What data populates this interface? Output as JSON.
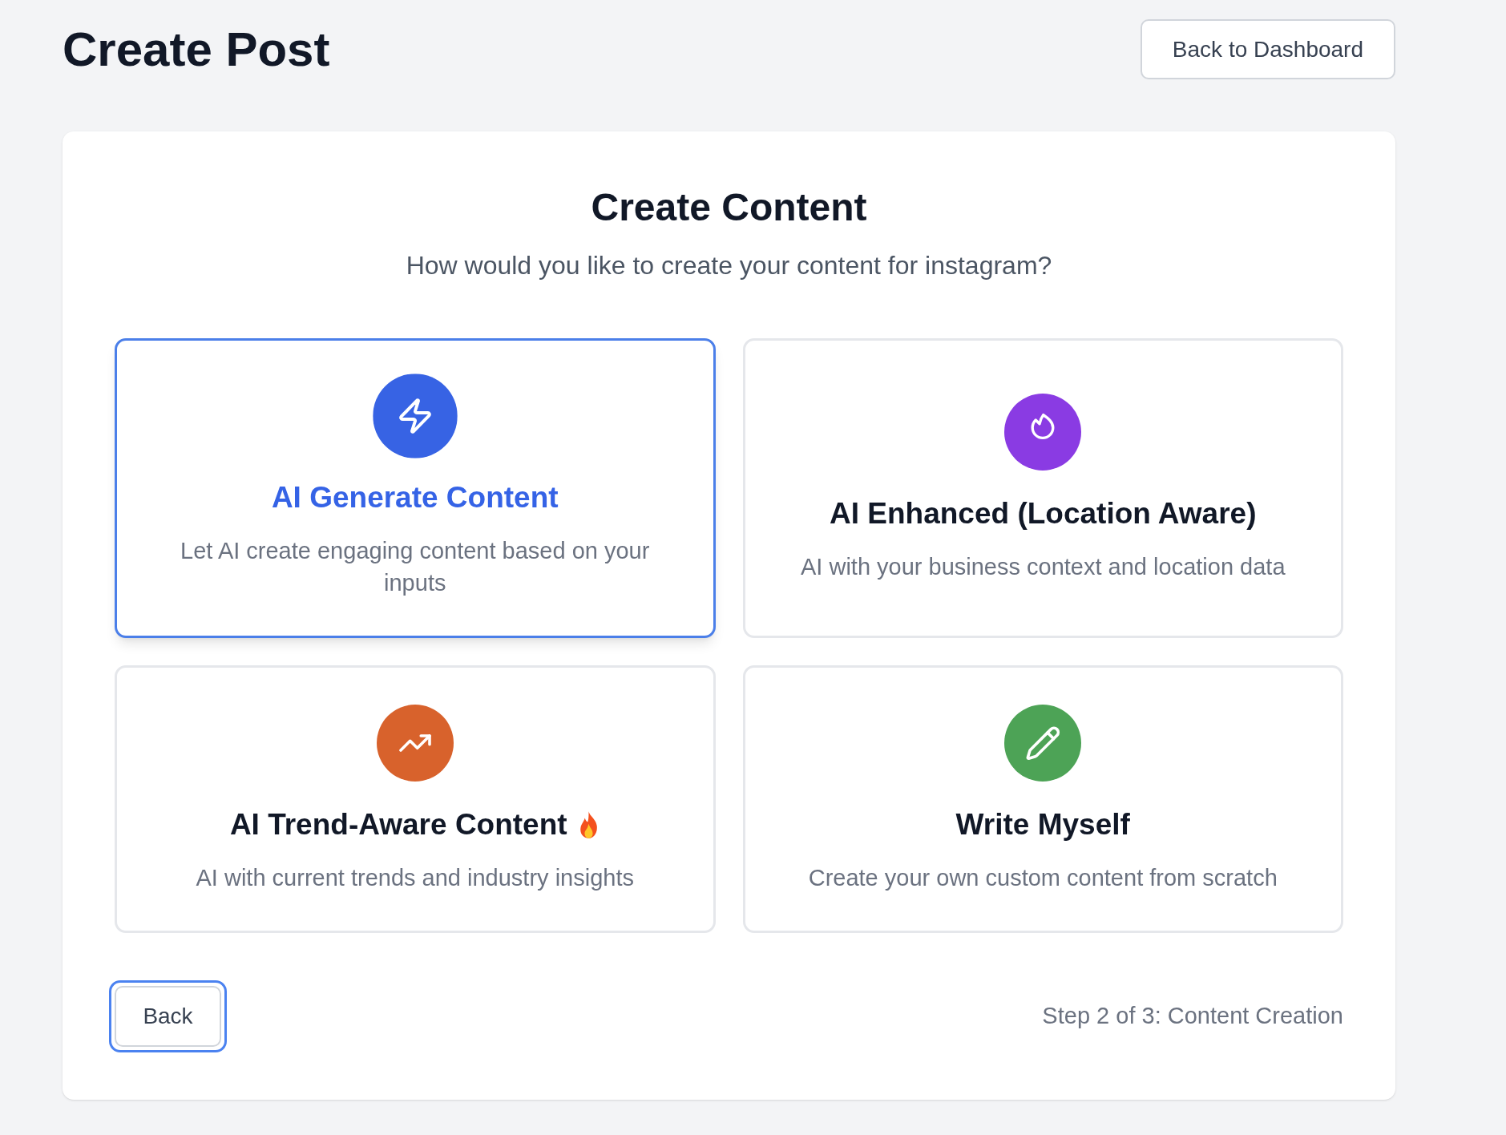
{
  "page": {
    "title": "Create Post",
    "back_to_dashboard_button": "Back to Dashboard"
  },
  "panel": {
    "heading": "Create Content",
    "subtitle": "How would you like to create your content for instagram?",
    "options": [
      {
        "title": "AI Generate Content",
        "description": "Let AI create engaging content based on your inputs",
        "color": "#3763e4",
        "selected": true
      },
      {
        "title": "AI Enhanced (Location Aware)",
        "description": "AI with your business context and location data",
        "color": "#8a3be3",
        "selected": false
      },
      {
        "title": "AI Trend-Aware Content",
        "description": "AI with current trends and industry insights",
        "color": "#d8622c",
        "selected": false
      },
      {
        "title": "Write Myself",
        "description": "Create your own custom content from scratch",
        "color": "#4da356",
        "selected": false
      }
    ],
    "back_button": {
      "label": "Back",
      "focused": true
    },
    "step_text": "Step 2 of 3: Content Creation"
  }
}
